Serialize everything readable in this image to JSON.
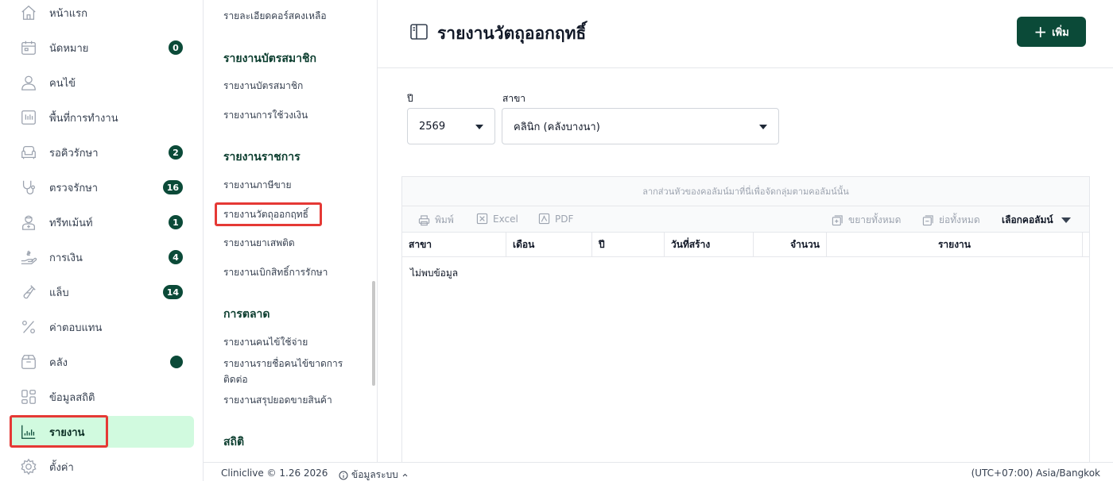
{
  "sidebar": {
    "items": [
      {
        "label": "หน้าแรก",
        "icon": "home-icon"
      },
      {
        "label": "นัดหมาย",
        "icon": "calendar-icon",
        "badge": "0"
      },
      {
        "label": "คนไข้",
        "icon": "user-icon"
      },
      {
        "label": "พื้นที่การทำงาน",
        "icon": "workspace-icon"
      },
      {
        "label": "รอคิวรักษา",
        "icon": "sofa-icon",
        "badge": "2"
      },
      {
        "label": "ตรวจรักษา",
        "icon": "stethoscope-icon",
        "badge": "16"
      },
      {
        "label": "ทรีทเม้นท์",
        "icon": "treatment-icon",
        "badge": "1"
      },
      {
        "label": "การเงิน",
        "icon": "money-hand-icon",
        "badge": "4"
      },
      {
        "label": "แล็บ",
        "icon": "test-tube-icon",
        "badge": "14"
      },
      {
        "label": "ค่าตอบแทน",
        "icon": "percent-icon"
      },
      {
        "label": "คลัง",
        "icon": "box-icon",
        "dot": true
      },
      {
        "label": "ข้อมูลสถิติ",
        "icon": "dashboard-icon"
      },
      {
        "label": "รายงาน",
        "icon": "report-chart-icon",
        "active": true
      },
      {
        "label": "ตั้งค่า",
        "icon": "gear-icon"
      }
    ]
  },
  "submenu": {
    "top_link": "รายละเอียดคอร์สคงเหลือ",
    "sections": [
      {
        "title": "รายงานบัตรสมาชิก",
        "links": [
          "รายงานบัตรสมาชิก",
          "รายงานการใช้วงเงิน"
        ]
      },
      {
        "title": "รายงานราชการ",
        "links": [
          "รายงานภาษีขาย",
          "รายงานวัตถุออกฤทธิ์",
          "รายงานยาเสพติด",
          "รายงานเบิกสิทธิ์การรักษา"
        ]
      },
      {
        "title": "การตลาด",
        "links": [
          "รายงานคนไข้ใช้จ่าย",
          "รายงานรายชื่อคนไข้ขาดการติดต่อ",
          "รายงานสรุปยอดขายสินค้า"
        ]
      },
      {
        "title": "สถิติ",
        "links": []
      }
    ]
  },
  "header": {
    "title": "รายงานวัตถุออกฤทธิ์",
    "add_label": "เพิ่ม"
  },
  "filters": {
    "year_label": "ปี",
    "year_value": "2569",
    "branch_label": "สาขา",
    "branch_value": "คลินิก (คลังบางนา)"
  },
  "grid": {
    "group_hint": "ลากส่วนหัวของคอลัมน์มาที่นี่เพื่อจัดกลุ่มตามคอลัมน์นั้น",
    "toolbar": {
      "print": "พิมพ์",
      "excel": "Excel",
      "pdf": "PDF",
      "expand_all": "ขยายทั้งหมด",
      "collapse_all": "ย่อทั้งหมด",
      "choose_columns": "เลือกคอลัมน์"
    },
    "columns": [
      "สาขา",
      "เดือน",
      "ปี",
      "วันที่สร้าง",
      "จำนวน",
      "รายงาน"
    ],
    "empty_text": "ไม่พบข้อมูล"
  },
  "footer": {
    "copyright": "Cliniclive © 1.26 2026",
    "system_info": "ข้อมูลระบบ",
    "timezone": "(UTC+07:00) Asia/Bangkok"
  },
  "colors": {
    "accent": "#0b4a38",
    "active_bg": "#d1fadf",
    "highlight": "#e53935"
  }
}
